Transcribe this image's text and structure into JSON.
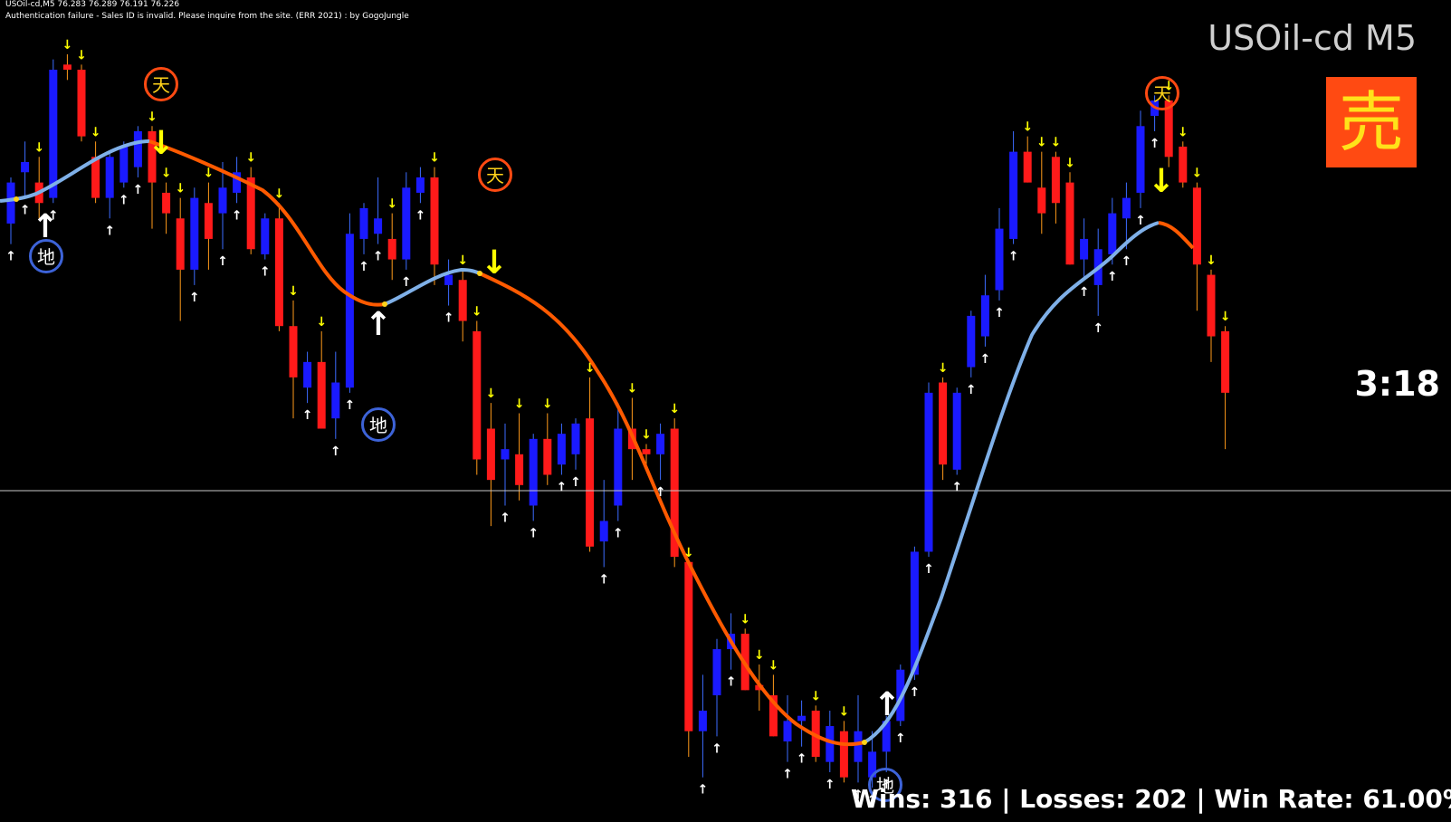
{
  "header": {
    "line1": "USOil-cd,M5  76.283 76.289 76.191 76.226",
    "line2": "Authentication failure - Sales ID is invalid. Please inquire from the site. (ERR 2021) : by GogoJungle"
  },
  "symbol_title": "USOil-cd M5",
  "signal_label": "売",
  "countdown": "3:18",
  "stats_text": "Wins: 316 | Losses: 202 | Win Rate: 61.00%",
  "markers": {
    "top_label": "天",
    "bottom_label": "地"
  },
  "colors": {
    "background": "#000000",
    "bull_candle": "#1a1aff",
    "bear_candle": "#ff1a1a",
    "wick_up": "#3d6cff",
    "wick_down": "#ff9a1a",
    "ma_down": "#ff5a00",
    "ma_up": "#7fb0e8",
    "arrow_up": "#ffffff",
    "arrow_down": "#ffff00",
    "signal_box": "#ff4a12"
  },
  "chart_data": {
    "type": "candlestick",
    "candles": [
      {
        "o": 76.1,
        "h": 76.19,
        "l": 76.06,
        "c": 76.18
      },
      {
        "o": 76.2,
        "h": 76.26,
        "l": 76.15,
        "c": 76.22
      },
      {
        "o": 76.18,
        "h": 76.23,
        "l": 76.11,
        "c": 76.14
      },
      {
        "o": 76.15,
        "h": 76.42,
        "l": 76.14,
        "c": 76.4
      },
      {
        "o": 76.41,
        "h": 76.43,
        "l": 76.38,
        "c": 76.4
      },
      {
        "o": 76.4,
        "h": 76.41,
        "l": 76.26,
        "c": 76.27
      },
      {
        "o": 76.23,
        "h": 76.26,
        "l": 76.14,
        "c": 76.15
      },
      {
        "o": 76.15,
        "h": 76.24,
        "l": 76.11,
        "c": 76.23
      },
      {
        "o": 76.18,
        "h": 76.26,
        "l": 76.17,
        "c": 76.25
      },
      {
        "o": 76.21,
        "h": 76.29,
        "l": 76.19,
        "c": 76.28
      },
      {
        "o": 76.28,
        "h": 76.29,
        "l": 76.09,
        "c": 76.18
      },
      {
        "o": 76.16,
        "h": 76.18,
        "l": 76.08,
        "c": 76.12
      },
      {
        "o": 76.11,
        "h": 76.15,
        "l": 75.91,
        "c": 76.01
      },
      {
        "o": 76.01,
        "h": 76.17,
        "l": 75.98,
        "c": 76.15
      },
      {
        "o": 76.14,
        "h": 76.18,
        "l": 76.01,
        "c": 76.07
      },
      {
        "o": 76.12,
        "h": 76.22,
        "l": 76.05,
        "c": 76.17
      },
      {
        "o": 76.16,
        "h": 76.23,
        "l": 76.14,
        "c": 76.2
      },
      {
        "o": 76.19,
        "h": 76.21,
        "l": 76.04,
        "c": 76.05
      },
      {
        "o": 76.04,
        "h": 76.12,
        "l": 76.03,
        "c": 76.11
      },
      {
        "o": 76.11,
        "h": 76.14,
        "l": 75.89,
        "c": 75.9
      },
      {
        "o": 75.9,
        "h": 75.95,
        "l": 75.72,
        "c": 75.8
      },
      {
        "o": 75.78,
        "h": 75.85,
        "l": 75.75,
        "c": 75.83
      },
      {
        "o": 75.83,
        "h": 75.89,
        "l": 75.7,
        "c": 75.7
      },
      {
        "o": 75.72,
        "h": 75.85,
        "l": 75.68,
        "c": 75.79
      },
      {
        "o": 75.78,
        "h": 76.12,
        "l": 75.77,
        "c": 76.08
      },
      {
        "o": 76.07,
        "h": 76.14,
        "l": 76.04,
        "c": 76.13
      },
      {
        "o": 76.08,
        "h": 76.19,
        "l": 76.06,
        "c": 76.11
      },
      {
        "o": 76.07,
        "h": 76.12,
        "l": 75.99,
        "c": 76.03
      },
      {
        "o": 76.03,
        "h": 76.2,
        "l": 76.01,
        "c": 76.17
      },
      {
        "o": 76.16,
        "h": 76.21,
        "l": 76.14,
        "c": 76.19
      },
      {
        "o": 76.19,
        "h": 76.21,
        "l": 75.98,
        "c": 76.02
      },
      {
        "o": 75.98,
        "h": 76.03,
        "l": 75.94,
        "c": 76.0
      },
      {
        "o": 75.99,
        "h": 76.01,
        "l": 75.87,
        "c": 75.91
      },
      {
        "o": 75.89,
        "h": 75.91,
        "l": 75.61,
        "c": 75.64
      },
      {
        "o": 75.7,
        "h": 75.75,
        "l": 75.51,
        "c": 75.6
      },
      {
        "o": 75.64,
        "h": 75.71,
        "l": 75.55,
        "c": 75.66
      },
      {
        "o": 75.65,
        "h": 75.73,
        "l": 75.56,
        "c": 75.59
      },
      {
        "o": 75.55,
        "h": 75.69,
        "l": 75.52,
        "c": 75.68
      },
      {
        "o": 75.68,
        "h": 75.73,
        "l": 75.59,
        "c": 75.61
      },
      {
        "o": 75.63,
        "h": 75.71,
        "l": 75.61,
        "c": 75.69
      },
      {
        "o": 75.65,
        "h": 75.72,
        "l": 75.62,
        "c": 75.71
      },
      {
        "o": 75.72,
        "h": 75.8,
        "l": 75.46,
        "c": 75.47
      },
      {
        "o": 75.48,
        "h": 75.6,
        "l": 75.43,
        "c": 75.52
      },
      {
        "o": 75.55,
        "h": 75.75,
        "l": 75.52,
        "c": 75.7
      },
      {
        "o": 75.7,
        "h": 75.76,
        "l": 75.6,
        "c": 75.66
      },
      {
        "o": 75.66,
        "h": 75.67,
        "l": 75.63,
        "c": 75.65
      },
      {
        "o": 75.65,
        "h": 75.71,
        "l": 75.6,
        "c": 75.69
      },
      {
        "o": 75.7,
        "h": 75.72,
        "l": 75.43,
        "c": 75.45
      },
      {
        "o": 75.44,
        "h": 75.12,
        "l": 75.06,
        "c": 75.11
      },
      {
        "o": 75.11,
        "h": 75.22,
        "l": 75.02,
        "c": 75.15
      },
      {
        "o": 75.18,
        "h": 75.29,
        "l": 75.1,
        "c": 75.27
      },
      {
        "o": 75.27,
        "h": 75.34,
        "l": 75.23,
        "c": 75.3
      },
      {
        "o": 75.3,
        "h": 75.31,
        "l": 75.19,
        "c": 75.19
      },
      {
        "o": 75.2,
        "h": 75.24,
        "l": 75.15,
        "c": 75.19
      },
      {
        "o": 75.18,
        "h": 75.22,
        "l": 75.1,
        "c": 75.1
      },
      {
        "o": 75.09,
        "h": 75.18,
        "l": 75.05,
        "c": 75.13
      },
      {
        "o": 75.13,
        "h": 75.17,
        "l": 75.08,
        "c": 75.14
      },
      {
        "o": 75.15,
        "h": 75.16,
        "l": 75.05,
        "c": 75.06
      },
      {
        "o": 75.05,
        "h": 75.15,
        "l": 75.03,
        "c": 75.12
      },
      {
        "o": 75.11,
        "h": 75.13,
        "l": 75.01,
        "c": 75.02
      },
      {
        "o": 75.05,
        "h": 75.18,
        "l": 75.01,
        "c": 75.11
      },
      {
        "o": 75.02,
        "h": 75.11,
        "l": 75.0,
        "c": 75.07
      },
      {
        "o": 75.07,
        "h": 75.14,
        "l": 75.03,
        "c": 75.13
      },
      {
        "o": 75.13,
        "h": 75.24,
        "l": 75.12,
        "c": 75.23
      },
      {
        "o": 75.22,
        "h": 75.47,
        "l": 75.21,
        "c": 75.46
      },
      {
        "o": 75.46,
        "h": 75.79,
        "l": 75.45,
        "c": 75.77
      },
      {
        "o": 75.79,
        "h": 75.8,
        "l": 75.6,
        "c": 75.63
      },
      {
        "o": 75.62,
        "h": 75.78,
        "l": 75.61,
        "c": 75.77
      },
      {
        "o": 75.82,
        "h": 75.93,
        "l": 75.8,
        "c": 75.92
      },
      {
        "o": 75.88,
        "h": 76.0,
        "l": 75.86,
        "c": 75.96
      },
      {
        "o": 75.97,
        "h": 76.13,
        "l": 75.95,
        "c": 76.09
      },
      {
        "o": 76.07,
        "h": 76.28,
        "l": 76.06,
        "c": 76.24
      },
      {
        "o": 76.24,
        "h": 76.27,
        "l": 76.18,
        "c": 76.18
      },
      {
        "o": 76.17,
        "h": 76.24,
        "l": 76.08,
        "c": 76.12
      },
      {
        "o": 76.23,
        "h": 76.24,
        "l": 76.1,
        "c": 76.14
      },
      {
        "o": 76.18,
        "h": 76.2,
        "l": 76.02,
        "c": 76.02
      },
      {
        "o": 76.03,
        "h": 76.11,
        "l": 75.99,
        "c": 76.07
      },
      {
        "o": 75.98,
        "h": 76.09,
        "l": 75.92,
        "c": 76.05
      },
      {
        "o": 76.04,
        "h": 76.15,
        "l": 76.02,
        "c": 76.12
      },
      {
        "o": 76.11,
        "h": 76.18,
        "l": 76.05,
        "c": 76.15
      },
      {
        "o": 76.16,
        "h": 76.32,
        "l": 76.13,
        "c": 76.29
      },
      {
        "o": 76.31,
        "h": 76.35,
        "l": 76.28,
        "c": 76.34
      },
      {
        "o": 76.34,
        "h": 76.35,
        "l": 76.21,
        "c": 76.23
      },
      {
        "o": 76.25,
        "h": 76.26,
        "l": 76.17,
        "c": 76.18
      },
      {
        "o": 76.17,
        "h": 76.18,
        "l": 75.93,
        "c": 76.02
      },
      {
        "o": 76.0,
        "h": 76.01,
        "l": 75.83,
        "c": 75.88
      },
      {
        "o": 75.89,
        "h": 75.9,
        "l": 75.66,
        "c": 75.77
      }
    ]
  }
}
